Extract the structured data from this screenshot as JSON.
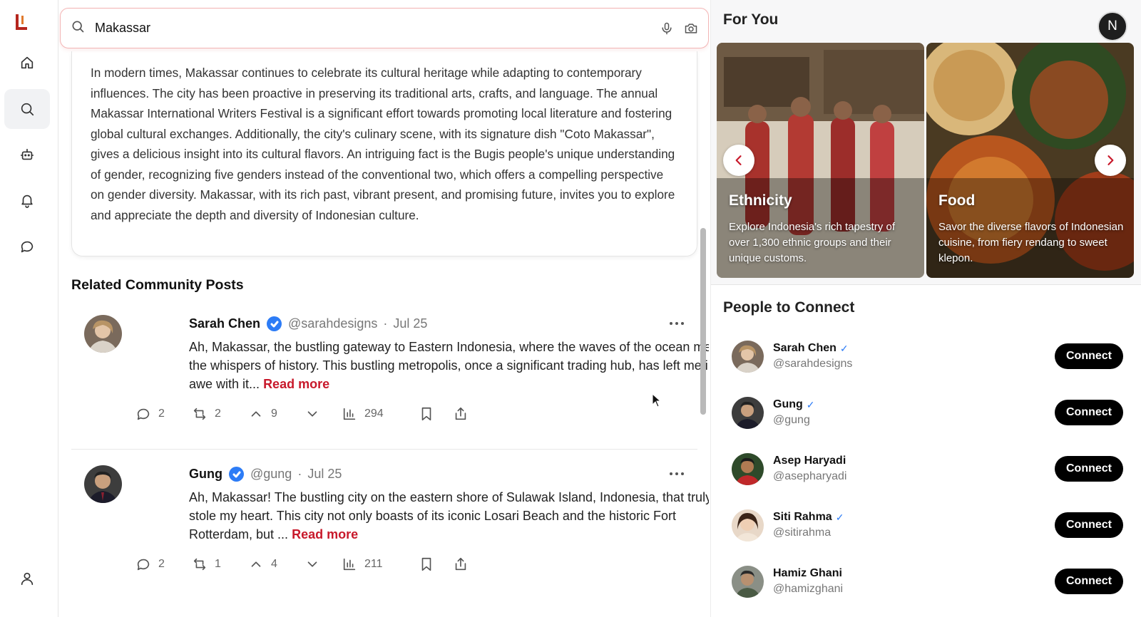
{
  "search": {
    "value": "Makassar"
  },
  "article": {
    "text": "In modern times, Makassar continues to celebrate its cultural heritage while adapting to contemporary influences. The city has been proactive in preserving its traditional arts, crafts, and language. The annual Makassar International Writers Festival is a significant effort towards promoting local literature and fostering global cultural exchanges. Additionally, the city's culinary scene, with its signature dish \"Coto Makassar\", gives a delicious insight into its cultural flavors. An intriguing fact is the Bugis people's unique understanding of gender, recognizing five genders instead of the conventional two, which offers a compelling perspective on gender diversity. Makassar, with its rich past, vibrant present, and promising future, invites you to explore and appreciate the depth and diversity of Indonesian culture."
  },
  "community": {
    "title": "Related Community Posts",
    "posts": [
      {
        "name": "Sarah Chen",
        "handle": "@sarahdesigns",
        "date": "Jul 25",
        "text": "Ah, Makassar, the bustling gateway to Eastern Indonesia, where the waves of the ocean meet the whispers of history. This bustling metropolis, once a significant trading hub, has left me in awe with it...",
        "read_more": "Read more",
        "comments": "2",
        "reposts": "2",
        "upvotes": "9",
        "views": "294"
      },
      {
        "name": "Gung",
        "handle": "@gung",
        "date": "Jul 25",
        "text": "Ah, Makassar! The bustling city on the eastern shore of Sulawak Island, Indonesia, that truly stole my heart. This city not only boasts of its iconic Losari Beach and the historic Fort Rotterdam, but ...",
        "read_more": "Read more",
        "comments": "2",
        "reposts": "1",
        "upvotes": "4",
        "views": "211"
      }
    ]
  },
  "right": {
    "for_you_title": "For You",
    "user_initial": "N",
    "cards": [
      {
        "title": "Ethnicity",
        "desc": "Explore Indonesia's rich tapestry of over 1,300 ethnic groups and their unique customs."
      },
      {
        "title": "Food",
        "desc": "Savor the diverse flavors of Indonesian cuisine, from fiery rendang to sweet klepon."
      }
    ],
    "people_title": "People to Connect",
    "connect_label": "Connect",
    "people": [
      {
        "name": "Sarah Chen",
        "handle": "@sarahdesigns",
        "verified": "✓"
      },
      {
        "name": "Gung",
        "handle": "@gung",
        "verified": "✓"
      },
      {
        "name": "Asep Haryadi",
        "handle": "@asepharyadi",
        "verified": ""
      },
      {
        "name": "Siti Rahma",
        "handle": "@sitirahma",
        "verified": "✓"
      },
      {
        "name": "Hamiz Ghani",
        "handle": "@hamizghani",
        "verified": ""
      }
    ]
  },
  "colors": {
    "accent": "#c8192b",
    "verified": "#2d7cf6"
  },
  "icons": [
    "logo-icon",
    "home-icon",
    "search-icon",
    "robot-icon",
    "bell-icon",
    "chat-icon",
    "profile-icon",
    "mic-icon",
    "camera-icon",
    "comment-icon",
    "repost-icon",
    "upvote-icon",
    "downvote-icon",
    "views-icon",
    "bookmark-icon",
    "share-icon",
    "more-icon",
    "chevron-left-icon",
    "chevron-right-icon"
  ]
}
